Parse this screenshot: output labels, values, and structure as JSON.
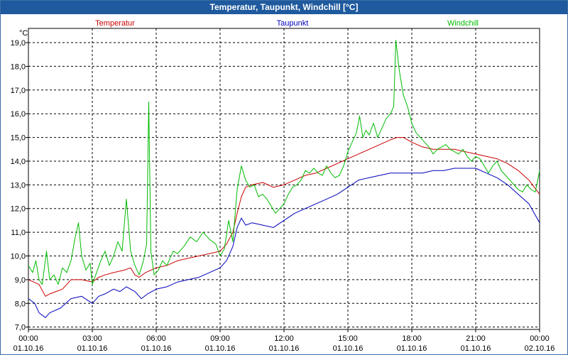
{
  "window": {
    "title": "Temperatur, Taupunkt, Windchill [°C]"
  },
  "colors": {
    "titlebar": "#1f5a9e",
    "grid": "#000000"
  },
  "chart_data": {
    "type": "line",
    "title": "Temperatur, Taupunkt, Windchill [°C]",
    "ylabel": "°C",
    "xlabel": "",
    "ylim": [
      6.9,
      19.6
    ],
    "xlim": [
      0,
      24
    ],
    "grid": true,
    "legend": "top",
    "yticks": [
      7.0,
      8.0,
      9.0,
      10.0,
      11.0,
      12.0,
      13.0,
      14.0,
      15.0,
      16.0,
      17.0,
      18.0,
      19.0
    ],
    "ytick_labels": [
      "7,0",
      "8,0",
      "9,0",
      "10,0",
      "11,0",
      "12,0",
      "13,0",
      "14,0",
      "15,0",
      "16,0",
      "17,0",
      "18,0",
      "19,0"
    ],
    "xticks": [
      0,
      3,
      6,
      9,
      12,
      15,
      18,
      21,
      24
    ],
    "xtick_labels": [
      [
        "00:00",
        "01.10.16"
      ],
      [
        "03:00",
        "01.10.16"
      ],
      [
        "06:00",
        "01.10.16"
      ],
      [
        "09:00",
        "01.10.16"
      ],
      [
        "12:00",
        "01.10.16"
      ],
      [
        "15:00",
        "01.10.16"
      ],
      [
        "18:00",
        "01.10.16"
      ],
      [
        "21:00",
        "01.10.16"
      ],
      [
        "00:00",
        "02.10.16"
      ]
    ],
    "series": [
      {
        "name": "Temperatur",
        "color": "#cc0000",
        "x": [
          0,
          0.5,
          0.8,
          1.0,
          1.3,
          1.6,
          2.0,
          2.5,
          3.0,
          3.3,
          3.6,
          4.0,
          4.5,
          4.8,
          5.0,
          5.2,
          5.5,
          6.0,
          6.5,
          7.0,
          7.5,
          8.0,
          8.5,
          9.0,
          9.3,
          9.6,
          9.8,
          10.0,
          10.2,
          10.5,
          11.0,
          11.5,
          12.0,
          12.5,
          13.0,
          13.5,
          14.0,
          14.5,
          15.0,
          15.5,
          16.0,
          16.5,
          17.0,
          17.3,
          17.6,
          18.0,
          18.5,
          19.0,
          19.5,
          20.0,
          20.5,
          21.0,
          21.5,
          22.0,
          22.5,
          23.0,
          23.5,
          24.0
        ],
        "y": [
          9.0,
          8.8,
          8.3,
          8.4,
          8.5,
          8.6,
          9.0,
          9.0,
          8.9,
          9.1,
          9.2,
          9.3,
          9.4,
          9.5,
          9.2,
          9.1,
          9.3,
          9.5,
          9.6,
          9.8,
          9.9,
          10.0,
          10.1,
          10.2,
          10.5,
          11.0,
          11.8,
          12.5,
          12.9,
          13.0,
          13.1,
          12.9,
          13.0,
          13.2,
          13.4,
          13.5,
          13.7,
          13.9,
          14.1,
          14.3,
          14.5,
          14.7,
          14.9,
          15.0,
          15.0,
          14.8,
          14.6,
          14.5,
          14.5,
          14.5,
          14.4,
          14.3,
          14.2,
          14.1,
          13.9,
          13.6,
          13.2,
          12.6
        ]
      },
      {
        "name": "Taupunkt",
        "color": "#0000bb",
        "x": [
          0,
          0.3,
          0.5,
          0.8,
          1.0,
          1.5,
          2.0,
          2.5,
          3.0,
          3.3,
          3.6,
          4.0,
          4.3,
          4.6,
          5.0,
          5.3,
          5.6,
          6.0,
          6.5,
          7.0,
          7.5,
          8.0,
          8.5,
          9.0,
          9.3,
          9.6,
          9.8,
          10.0,
          10.2,
          10.5,
          11.0,
          11.5,
          12.0,
          12.5,
          13.0,
          13.5,
          14.0,
          14.5,
          15.0,
          15.5,
          16.0,
          16.5,
          17.0,
          17.5,
          18.0,
          18.5,
          19.0,
          19.5,
          20.0,
          20.5,
          21.0,
          21.5,
          22.0,
          22.5,
          23.0,
          23.5,
          24.0
        ],
        "y": [
          8.2,
          8.0,
          7.6,
          7.4,
          7.6,
          7.8,
          8.2,
          8.3,
          8.0,
          8.3,
          8.4,
          8.6,
          8.5,
          8.7,
          8.5,
          8.2,
          8.4,
          8.6,
          8.7,
          8.9,
          9.0,
          9.1,
          9.3,
          9.5,
          9.8,
          10.4,
          11.2,
          11.6,
          11.3,
          11.4,
          11.3,
          11.2,
          11.5,
          11.8,
          12.0,
          12.2,
          12.4,
          12.6,
          12.9,
          13.2,
          13.3,
          13.4,
          13.5,
          13.5,
          13.5,
          13.5,
          13.6,
          13.6,
          13.7,
          13.7,
          13.7,
          13.5,
          13.3,
          13.0,
          12.6,
          12.2,
          11.4
        ]
      },
      {
        "name": "Windchill",
        "color": "#00bb00",
        "x": [
          0,
          0.2,
          0.35,
          0.5,
          0.65,
          0.85,
          1.0,
          1.2,
          1.4,
          1.6,
          1.8,
          2.0,
          2.2,
          2.35,
          2.5,
          2.7,
          2.9,
          3.0,
          3.2,
          3.4,
          3.6,
          3.8,
          4.0,
          4.2,
          4.4,
          4.6,
          4.8,
          5.0,
          5.2,
          5.4,
          5.55,
          5.65,
          5.75,
          5.9,
          6.1,
          6.3,
          6.5,
          6.8,
          7.0,
          7.3,
          7.6,
          7.9,
          8.2,
          8.5,
          8.8,
          9.0,
          9.2,
          9.4,
          9.6,
          9.8,
          10.0,
          10.2,
          10.4,
          10.6,
          10.8,
          11.0,
          11.2,
          11.4,
          11.6,
          11.8,
          12.0,
          12.2,
          12.4,
          12.6,
          12.8,
          13.0,
          13.2,
          13.4,
          13.6,
          13.8,
          14.0,
          14.2,
          14.4,
          14.6,
          14.8,
          15.0,
          15.2,
          15.4,
          15.55,
          15.7,
          15.85,
          16.0,
          16.2,
          16.4,
          16.6,
          16.8,
          17.0,
          17.15,
          17.25,
          17.4,
          17.6,
          17.8,
          18.0,
          18.2,
          18.4,
          18.6,
          18.8,
          19.0,
          19.2,
          19.4,
          19.6,
          19.8,
          20.0,
          20.2,
          20.4,
          20.6,
          20.8,
          21.0,
          21.2,
          21.4,
          21.6,
          21.8,
          22.0,
          22.2,
          22.4,
          22.6,
          22.8,
          23.0,
          23.2,
          23.4,
          23.6,
          23.8,
          24.0
        ],
        "y": [
          9.6,
          9.3,
          9.8,
          9.0,
          8.8,
          10.2,
          9.0,
          9.2,
          8.8,
          9.5,
          9.3,
          9.8,
          10.8,
          11.4,
          10.0,
          9.4,
          9.7,
          8.8,
          9.3,
          9.8,
          10.2,
          9.6,
          10.0,
          10.6,
          10.2,
          12.4,
          10.2,
          9.6,
          9.2,
          9.8,
          10.5,
          16.5,
          10.2,
          9.2,
          9.4,
          9.8,
          9.6,
          10.2,
          10.1,
          10.4,
          10.8,
          10.6,
          11.0,
          10.7,
          10.5,
          10.0,
          10.3,
          11.5,
          10.6,
          12.8,
          13.8,
          13.2,
          12.9,
          13.0,
          12.5,
          12.6,
          12.4,
          12.1,
          11.8,
          12.0,
          12.2,
          12.6,
          12.9,
          13.0,
          13.2,
          13.6,
          13.5,
          13.7,
          13.5,
          13.4,
          13.8,
          13.5,
          13.3,
          13.4,
          13.8,
          14.4,
          14.8,
          15.2,
          15.9,
          15.0,
          15.3,
          15.1,
          15.6,
          15.0,
          15.4,
          15.8,
          16.0,
          16.3,
          19.1,
          17.9,
          16.8,
          16.3,
          15.6,
          15.2,
          15.0,
          14.8,
          14.6,
          14.3,
          14.5,
          14.6,
          14.7,
          14.5,
          14.4,
          14.3,
          14.5,
          14.2,
          14.0,
          14.2,
          14.1,
          13.8,
          13.5,
          13.8,
          14.0,
          13.6,
          13.4,
          13.2,
          13.0,
          12.8,
          12.7,
          13.0,
          12.8,
          12.7,
          13.6
        ]
      }
    ]
  }
}
